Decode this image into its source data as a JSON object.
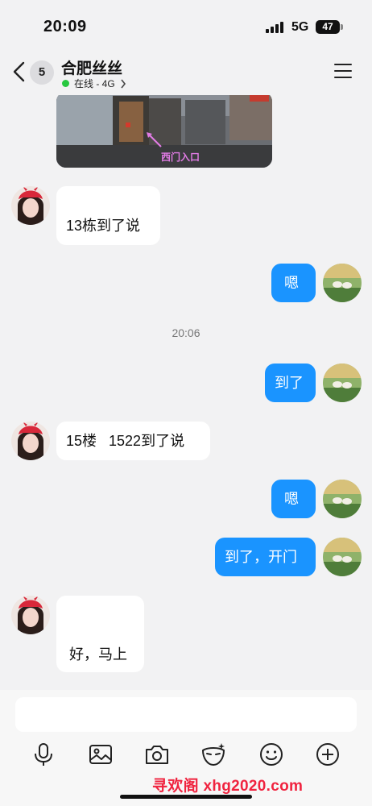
{
  "status_bar": {
    "time": "20:09",
    "network": "5G",
    "battery": "47"
  },
  "header": {
    "unread_count": "5",
    "contact_name": "合肥丝丝",
    "presence": "在线 - 4G",
    "presence_color": "#28c840"
  },
  "messages": {
    "photo": {
      "caption": "西门入口"
    },
    "m1": "13栋到了说",
    "m2": "嗯",
    "timestamp": "20:06",
    "m3": "到了",
    "m4": "15楼   1522到了说",
    "m5": "嗯",
    "m6": "到了，开门",
    "m7": "好，马上"
  },
  "input": {
    "placeholder": ""
  },
  "toolbar": {
    "icons": [
      "microphone-icon",
      "image-icon",
      "camera-icon",
      "mask-icon",
      "emoji-icon",
      "plus-icon"
    ]
  },
  "watermark": "寻欢阁 xhg2020.com",
  "colors": {
    "accent": "#1a94ff",
    "incoming_bubble": "#ffffff",
    "background": "#f2f2f3",
    "watermark": "#f0233f"
  }
}
